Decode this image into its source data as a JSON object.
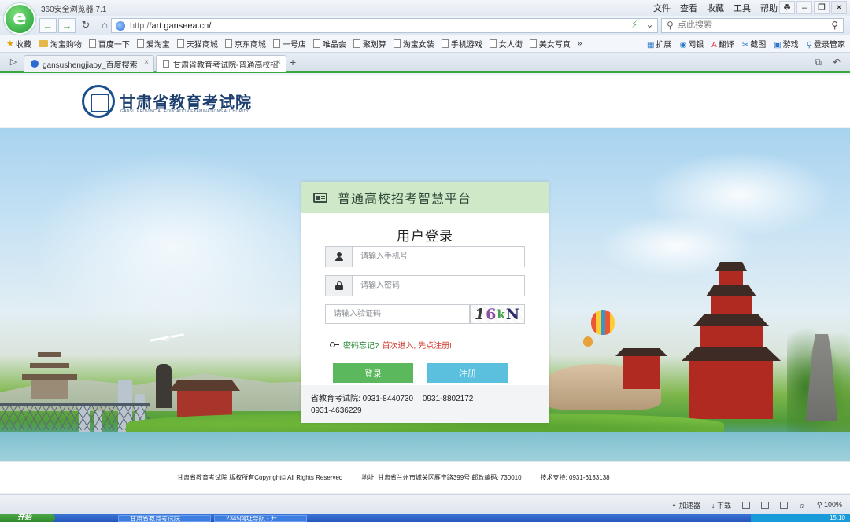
{
  "browser": {
    "title": "360安全浏览器 7.1",
    "menu": [
      "文件",
      "查看",
      "收藏",
      "工具",
      "帮助"
    ],
    "url_prefix": "http://",
    "url_domain": "art.ganseea.cn/",
    "search_placeholder": "点此搜索",
    "bookmarks": [
      "收藏",
      "淘宝购物",
      "百度一下",
      "爱淘宝",
      "天猫商城",
      "京东商城",
      "一号店",
      "唯品会",
      "聚划算",
      "淘宝女装",
      "手机游戏",
      "女人街",
      "美女写真"
    ],
    "bookmark_tools": [
      "扩展",
      "网银",
      "翻译",
      "截图",
      "游戏",
      "登录管家"
    ],
    "tabs": [
      {
        "label": "gansushengjiaoy_百度搜索"
      },
      {
        "label": "甘肃省教育考试院-普通高校招"
      }
    ],
    "status_items": [
      "加速器",
      "下载",
      "100%"
    ]
  },
  "site": {
    "name": "甘肃省教育考试院",
    "subtitle": "GANSU PROVINCIAL EDUCATION EXAMINATIONS AUTHORITY"
  },
  "login": {
    "platform_title": "普通高校招考智慧平台",
    "heading": "用户登录",
    "phone_placeholder": "请输入手机号",
    "password_placeholder": "请输入密码",
    "captcha_placeholder": "请输入验证码",
    "captcha_chars": [
      "1",
      "6",
      "k",
      "N"
    ],
    "forgot_link": "密码忘记?",
    "first_visit_link": "首次进入, 先点注册!",
    "login_button": "登录",
    "register_button": "注册",
    "contact_label": "省教育考试院:",
    "phones": [
      "0931-8440730",
      "0931-8802172",
      "0931-4636229"
    ]
  },
  "footer": {
    "copyright": "甘肃省教育考试院 版权所有Copyright© All Rights Reserved",
    "address": "地址: 甘肃省兰州市城关区雁宁路399号 邮政编码: 730010",
    "support": "技术支持: 0931-6133138"
  },
  "taskbar": {
    "start": "开始",
    "tasks": [
      "甘肃省教育考试院",
      "2345网址导航 - 开"
    ],
    "clock": "15:10"
  }
}
